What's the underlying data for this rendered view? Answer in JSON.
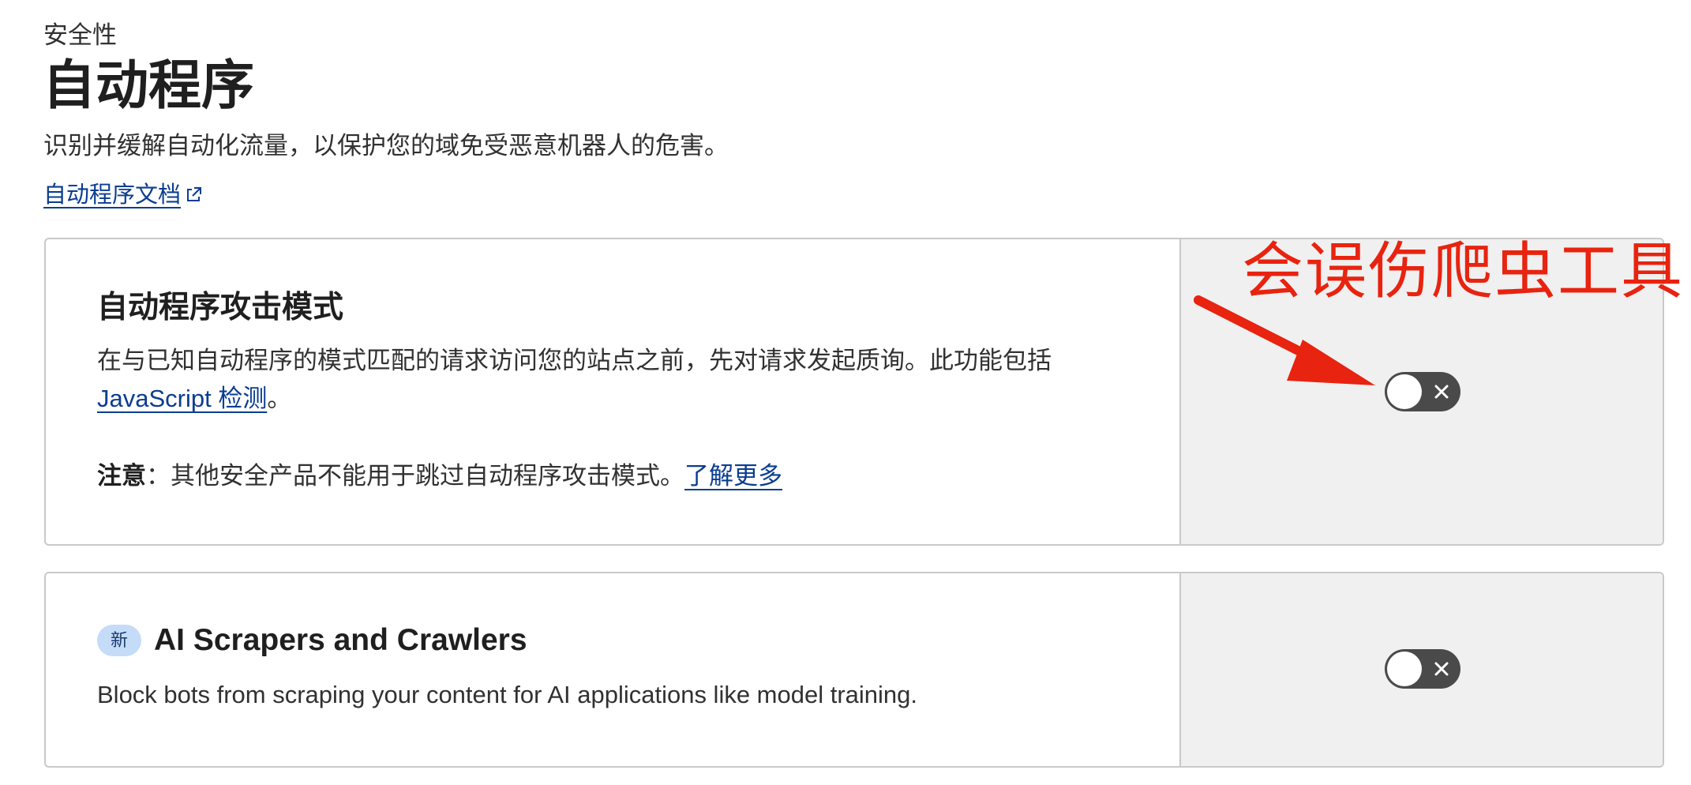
{
  "header": {
    "eyebrow": "安全性",
    "title": "自动程序",
    "description": "识别并缓解自动化流量，以保护您的域免受恶意机器人的危害。",
    "docs_link": "自动程序文档"
  },
  "cards": [
    {
      "title": "自动程序攻击模式",
      "body_text": "在与已知自动程序的模式匹配的请求访问您的站点之前，先对请求发起质询。此功能包括",
      "body_link": "JavaScript 检测",
      "body_suffix": "。",
      "note_label": "注意",
      "note_sep": "：",
      "note_text": "其他安全产品不能用于跳过自动程序攻击模式。",
      "note_link": "了解更多",
      "toggle_state": "off"
    },
    {
      "badge": "新",
      "title": "AI Scrapers and Crawlers",
      "body_text": "Block bots from scraping your content for AI applications like model training.",
      "toggle_state": "off"
    }
  ],
  "annotation": {
    "text": "会误伤爬虫工具",
    "color": "#e8230f"
  },
  "icons": {
    "external_link": "external-link-icon",
    "toggle_off": "close-icon"
  },
  "colors": {
    "link": "#0a3d91",
    "toggle_bg": "#4a4a4a",
    "badge_bg": "#c4dcf8",
    "side_panel": "#f0f0f0"
  }
}
